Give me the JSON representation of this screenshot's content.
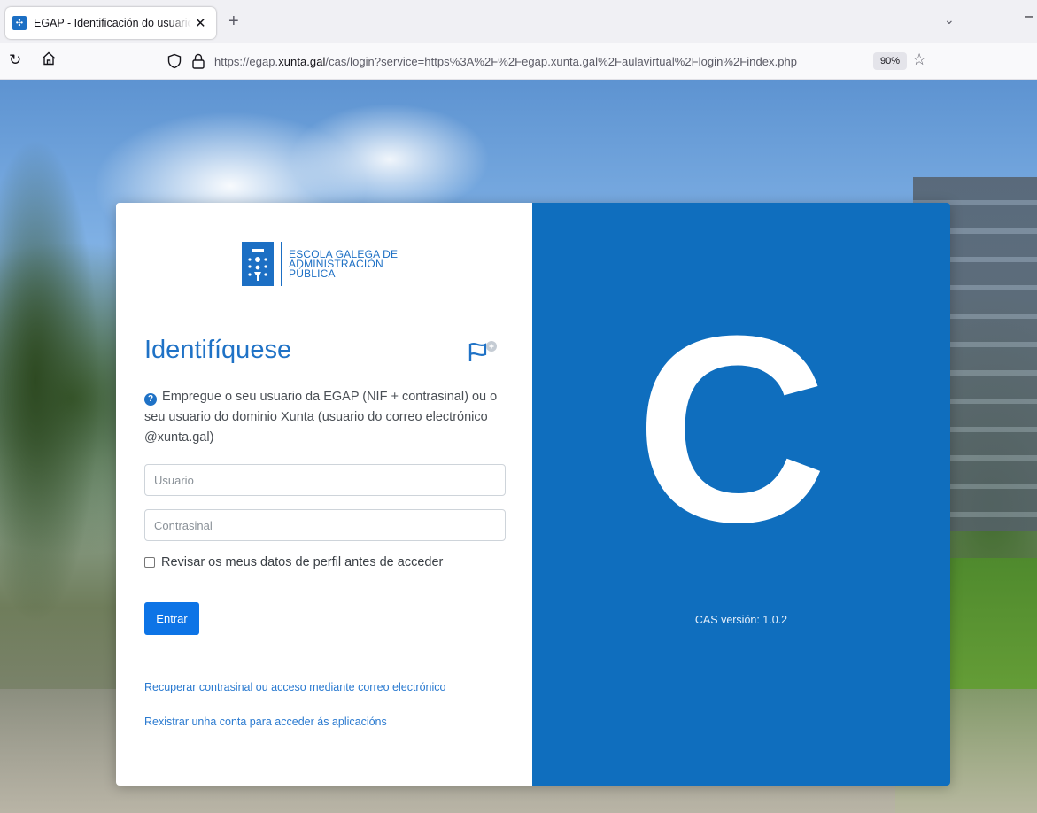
{
  "browser": {
    "tab_title": "EGAP - Identificación do usuario",
    "new_tab_label": "+",
    "url_prefix": "https://egap.",
    "url_domain": "xunta.gal",
    "url_path": "/cas/login?service=https%3A%2F%2Fegap.xunta.gal%2Faulavirtual%2Flogin%2Findex.php",
    "zoom": "90%"
  },
  "login": {
    "logo_lines": [
      "ESCOLA GALEGA DE",
      "ADMINISTRACIÓN",
      "PÚBLICA"
    ],
    "title": "Identifíquese",
    "info_text": "Empregue o seu usuario da EGAP (NIF + contrasinal) ou o seu usuario do dominio Xunta (usuario do correo electrónico @xunta.gal)",
    "username_placeholder": "Usuario",
    "password_placeholder": "Contrasinal",
    "checkbox_label": "Revisar os meus datos de perfil antes de acceder",
    "submit_label": "Entrar",
    "recover_link": "Recuperar contrasinal ou acceso mediante correo electrónico",
    "register_link": "Rexistrar unha conta para acceder ás aplicacións"
  },
  "cas": {
    "logo_letter": "C",
    "version": "CAS versión: 1.0.2",
    "panel_color": "#0f6ebe"
  }
}
